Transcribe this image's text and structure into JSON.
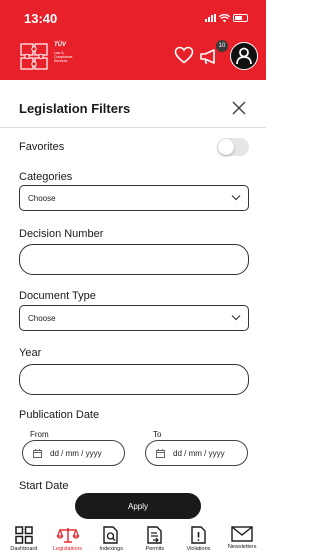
{
  "status_bar": {
    "time": "13:40"
  },
  "header": {
    "logo_brand": "TÜV",
    "logo_subtitle": "Law & Compliance Services",
    "notification_count": "10",
    "accent_color": "#e8202a"
  },
  "sheet": {
    "title": "Legislation Filters",
    "favorites_label": "Favorites",
    "favorites_on": false,
    "categories_label": "Categories",
    "categories_value": "Choose",
    "decision_number_label": "Decision Number",
    "decision_number_value": "",
    "document_type_label": "Document Type",
    "document_type_value": "Choose",
    "year_label": "Year",
    "year_value": "",
    "publication_date_label": "Publication Date",
    "from_label": "From",
    "to_label": "To",
    "date_placeholder": "dd / mm / yyyy",
    "start_date_label": "Start Date",
    "apply_label": "Apply"
  },
  "tabs": [
    {
      "label": "Dashboard",
      "icon": "grid-icon",
      "active": false
    },
    {
      "label": "Legislations",
      "icon": "scale-icon",
      "active": true
    },
    {
      "label": "Indexings",
      "icon": "document-search-icon",
      "active": false
    },
    {
      "label": "Permits",
      "icon": "document-permit-icon",
      "active": false
    },
    {
      "label": "Violations",
      "icon": "document-alert-icon",
      "active": false
    },
    {
      "label": "Newsletters",
      "icon": "mail-icon",
      "active": false
    }
  ]
}
